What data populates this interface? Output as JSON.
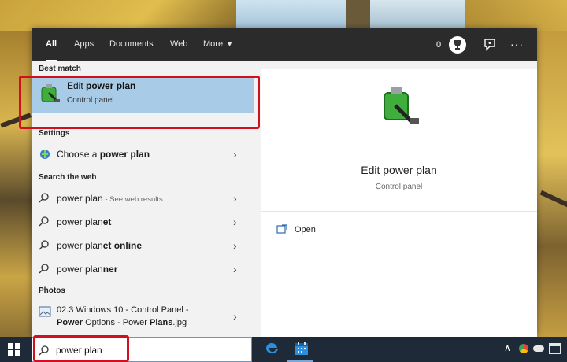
{
  "tabs": [
    {
      "label": "All",
      "active": true
    },
    {
      "label": "Apps"
    },
    {
      "label": "Documents"
    },
    {
      "label": "Web"
    },
    {
      "label": "More"
    }
  ],
  "header": {
    "points": "0",
    "trophy_icon": "trophy-icon",
    "feedback_icon": "feedback-icon",
    "more_icon": "ellipsis-icon",
    "more_glyph": "···"
  },
  "best_match": {
    "section": "Best match",
    "title_plain": "Edit ",
    "title_bold": "power plan",
    "subtitle": "Control panel",
    "icon": "battery-plug-icon"
  },
  "settings": {
    "section": "Settings",
    "items": [
      {
        "plain": "Choose a ",
        "bold": "power plan",
        "icon": "power-globe-icon"
      }
    ]
  },
  "web": {
    "section": "Search the web",
    "items": [
      {
        "plain": "power plan",
        "bold": "",
        "hint": " - See web results"
      },
      {
        "plain": "power plan",
        "bold": "et",
        "hint": ""
      },
      {
        "plain": "power plan",
        "bold": "et online",
        "hint": ""
      },
      {
        "plain": "power plan",
        "bold": "ner",
        "hint": ""
      }
    ]
  },
  "photos": {
    "section": "Photos",
    "line1": "02.3 Windows 10 - Control Panel -",
    "line2_bold1": "Power",
    "line2_plain1": " Options - Power ",
    "line2_bold2": "Plans",
    "line2_plain2": ".jpg",
    "icon": "image-file-icon"
  },
  "preview": {
    "title": "Edit power plan",
    "subtitle": "Control panel",
    "open_label": "Open",
    "open_icon": "open-window-icon"
  },
  "taskbar": {
    "search_value": "power plan",
    "icons": [
      "windows-logo-icon",
      "search-icon",
      "edge-icon",
      "calendar-icon",
      "tray-chevron-icon",
      "chrome-icon",
      "cloud-icon",
      "display-icon"
    ]
  },
  "colors": {
    "highlight": "#a8cbe8",
    "header": "#2b2b2b",
    "annotation": "#d20f1e",
    "taskbar": "#1f2a38"
  }
}
